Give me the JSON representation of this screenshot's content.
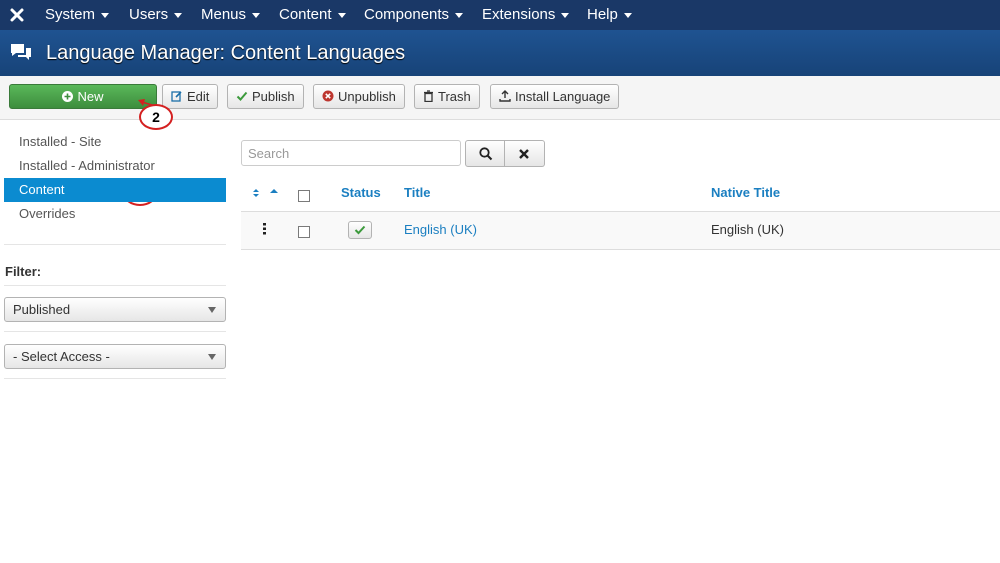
{
  "navbar": {
    "menus": [
      {
        "label": "System"
      },
      {
        "label": "Users"
      },
      {
        "label": "Menus"
      },
      {
        "label": "Content"
      },
      {
        "label": "Components"
      },
      {
        "label": "Extensions"
      },
      {
        "label": "Help"
      }
    ]
  },
  "header": {
    "title": "Language Manager: Content Languages",
    "icon": "comments-icon"
  },
  "toolbar": {
    "new_label": "New",
    "edit_label": "Edit",
    "publish_label": "Publish",
    "unpublish_label": "Unpublish",
    "trash_label": "Trash",
    "install_label": "Install Language"
  },
  "annotations": {
    "callout_1": "1",
    "callout_2": "2"
  },
  "sidebar": {
    "items": [
      {
        "label": "Installed - Site"
      },
      {
        "label": "Installed - Administrator"
      },
      {
        "label": "Content"
      },
      {
        "label": "Overrides"
      }
    ],
    "active_index": 2,
    "filter_label": "Filter:",
    "status_select": "Published",
    "access_select": "- Select Access -"
  },
  "search": {
    "placeholder": "Search"
  },
  "table": {
    "headers": {
      "status": "Status",
      "title": "Title",
      "native_title": "Native Title"
    },
    "rows": [
      {
        "status": "published",
        "title": "English (UK)",
        "native_title": "English (UK)"
      }
    ]
  },
  "colors": {
    "navbar": "#1a3867",
    "header": "#1f5391",
    "accent": "#0b8bd0",
    "new_button": "#4cae4c",
    "link": "#1b7fc1"
  }
}
